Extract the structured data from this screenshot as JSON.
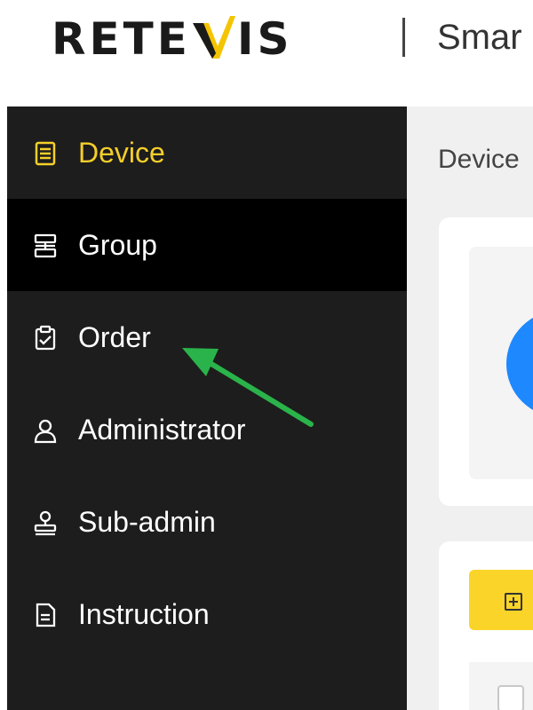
{
  "header": {
    "logo_text_left": "RETE",
    "logo_text_right": "IS",
    "title": "Smar"
  },
  "sidebar": {
    "items": [
      {
        "label": "Device",
        "icon": "document-list-icon",
        "selected": true
      },
      {
        "label": "Group",
        "icon": "group-stack-icon"
      },
      {
        "label": "Order",
        "icon": "clipboard-check-icon"
      },
      {
        "label": "Administrator",
        "icon": "user-icon"
      },
      {
        "label": "Sub-admin",
        "icon": "stamp-user-icon"
      },
      {
        "label": "Instruction",
        "icon": "file-icon"
      }
    ]
  },
  "main": {
    "breadcrumb": "Device"
  },
  "colors": {
    "sidebar_bg": "#1d1d1d",
    "accent_yellow": "#f5cf2a",
    "button_yellow": "#fbd42a",
    "blue": "#1e88ff",
    "arrow_green": "#2ab34a"
  }
}
